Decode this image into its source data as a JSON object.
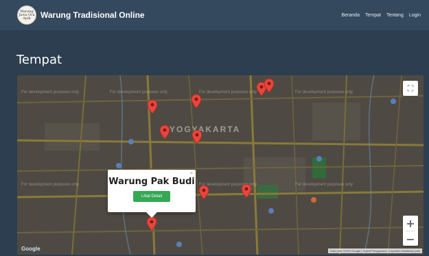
{
  "navbar": {
    "brand": "Warung Tradisional Online",
    "logo_text": "Warung Jawa Ora Apik",
    "links": [
      "Beranda",
      "Tempat",
      "Tentang",
      "Login"
    ]
  },
  "page": {
    "title": "Tempat"
  },
  "map": {
    "dev_watermark": "For development purposes only",
    "district_label": "YOGYAKARTA",
    "google_logo": "Google",
    "attribution": "Data peta ©2022 Google | Syarat Penggunaan | Laporkan kesalahan peta",
    "pin_color": "#e8453c",
    "info_window": {
      "title": "Warung Pak Budi",
      "button_label": "Lihat Detail",
      "button_color": "#34a853",
      "close_glyph": "×"
    },
    "controls": {
      "fullscreen_icon": "⛶",
      "zoom_in": "+",
      "zoom_out": "−"
    }
  }
}
